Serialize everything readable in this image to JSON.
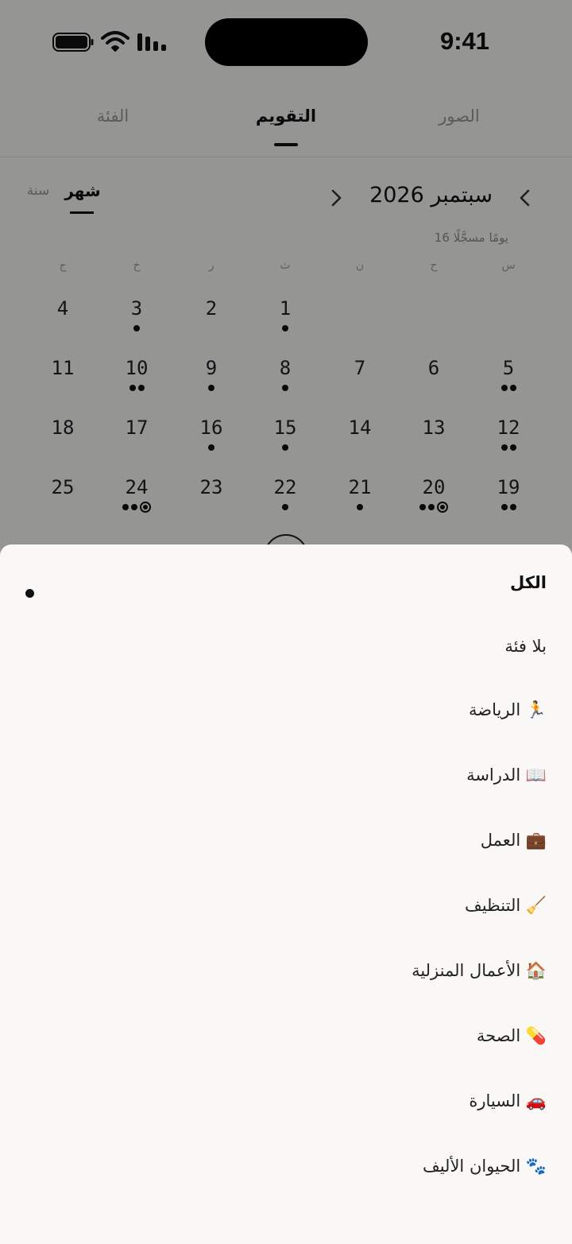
{
  "status_bar": {
    "time": "9:41",
    "icons": [
      "battery-icon",
      "wifi-icon",
      "cellular-signal-icon"
    ]
  },
  "tabs": [
    {
      "label": "الصور",
      "active": false
    },
    {
      "label": "التقويم",
      "active": true
    },
    {
      "label": "الفئة",
      "active": false
    }
  ],
  "calendar": {
    "month_title": "سبتمبر 2026",
    "prev_icon": "chevron-left-icon",
    "next_icon": "chevron-right-icon",
    "view_month": "شهر",
    "view_year": "سنة",
    "logged_days": "16 يومًا مسجَّلًا",
    "weekdays": [
      "س",
      "ح",
      "ن",
      "ث",
      "ر",
      "خ",
      "ج"
    ],
    "weeks": [
      [
        null,
        null,
        null,
        {
          "day": "1",
          "dots": 1
        },
        {
          "day": "2",
          "dots": 0
        },
        {
          "day": "3",
          "dots": 1
        },
        {
          "day": "4",
          "dots": 0
        }
      ],
      [
        {
          "day": "5",
          "dots": 2
        },
        {
          "day": "6",
          "dots": 0
        },
        {
          "day": "7",
          "dots": 0
        },
        {
          "day": "8",
          "dots": 1
        },
        {
          "day": "9",
          "dots": 1
        },
        {
          "day": "10",
          "dots": 2
        },
        {
          "day": "11",
          "dots": 0
        }
      ],
      [
        {
          "day": "12",
          "dots": 2
        },
        {
          "day": "13",
          "dots": 0
        },
        {
          "day": "14",
          "dots": 0
        },
        {
          "day": "15",
          "dots": 1
        },
        {
          "day": "16",
          "dots": 1
        },
        {
          "day": "17",
          "dots": 0
        },
        {
          "day": "18",
          "dots": 0
        }
      ],
      [
        {
          "day": "19",
          "dots": 2
        },
        {
          "day": "20",
          "dots": 2,
          "ring": true
        },
        {
          "day": "21",
          "dots": 1
        },
        {
          "day": "22",
          "dots": 1
        },
        {
          "day": "23",
          "dots": 0
        },
        {
          "day": "24",
          "dots": 2,
          "ring": true
        },
        {
          "day": "25",
          "dots": 0
        }
      ]
    ]
  },
  "category_sheet": {
    "items": [
      {
        "label": "الكل",
        "selected": true
      },
      {
        "label": "بلا فئة",
        "selected": false
      },
      {
        "label": "🏃 الرياضة",
        "selected": false
      },
      {
        "label": "📖 الدراسة",
        "selected": false
      },
      {
        "label": "💼 العمل",
        "selected": false
      },
      {
        "label": "🧹 التنظيف",
        "selected": false
      },
      {
        "label": "🏠 الأعمال المنزلية",
        "selected": false
      },
      {
        "label": "💊 الصحة",
        "selected": false
      },
      {
        "label": "🚗 السيارة",
        "selected": false
      },
      {
        "label": "🐾 الحيوان الأليف",
        "selected": false
      }
    ]
  }
}
